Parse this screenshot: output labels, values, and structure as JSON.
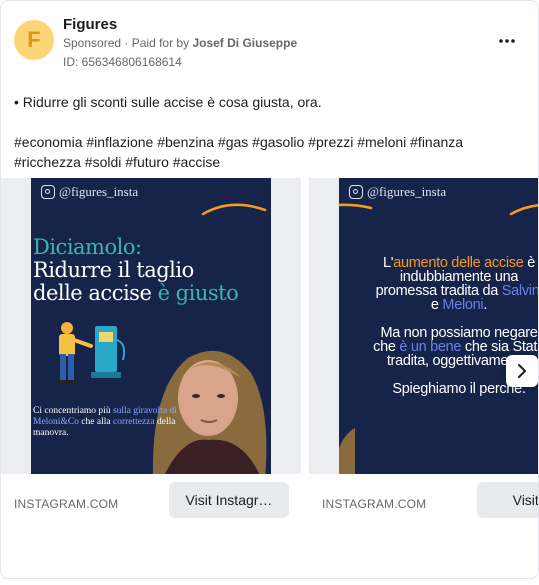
{
  "header": {
    "avatar_letter": "F",
    "page_name": "Figures",
    "sponsored": "Sponsored",
    "paid_for_prefix": "· Paid for by",
    "payer": "Josef Di Giuseppe",
    "ad_id": "ID: 656346806168614",
    "more_icon": "more-horizontal-icon"
  },
  "post": {
    "text_line": "• Ridurre gli sconti sulle accise è cosa giusta, ora.",
    "hashtags": "#economia #inflazione #benzina #gas #gasolio #prezzi #meloni #finanza #ricchezza #soldi #futuro #accise"
  },
  "colors": {
    "avatar_bg": "#fcd576",
    "poster_bg": "#16244a",
    "teal_accent": "#38b7b0",
    "orange_accent": "#f59a23",
    "cta_bg": "#e9eaed"
  },
  "carousel": {
    "slides": [
      {
        "handle": "@figures_insta",
        "headline_1": "Diciamolo:",
        "headline_2": "Ridurre il taglio",
        "headline_3": "delle accise",
        "headline_4": "è giusto",
        "caption_1": "Ci concentriamo più ",
        "caption_2": "sulla giravolta di Meloni&Co",
        "caption_3": " che alla ",
        "caption_4": "correttezza",
        "caption_5": " della manovra.",
        "domain": "INSTAGRAM.COM",
        "cta": "Visit Instagr…"
      },
      {
        "handle": "@figures_insta",
        "l1a": "L'",
        "l1b": "aumento delle accise",
        "l1c": " è",
        "l2": "indubbiamente una",
        "l3a": "promessa tradita da ",
        "l3b": "Salvini",
        "l4a": "e ",
        "l4b": "Meloni",
        "l4c": ".",
        "l5": "Ma non possiamo negare",
        "l6a": "che ",
        "l6b": "è un bene",
        "l6c": " che sia Stata",
        "l7": "tradita, oggettivamente.",
        "l8": "Spieghiamo il perché.",
        "domain": "INSTAGRAM.COM",
        "cta": "Visit Ins"
      }
    ],
    "next_icon": "chevron-right-icon"
  }
}
